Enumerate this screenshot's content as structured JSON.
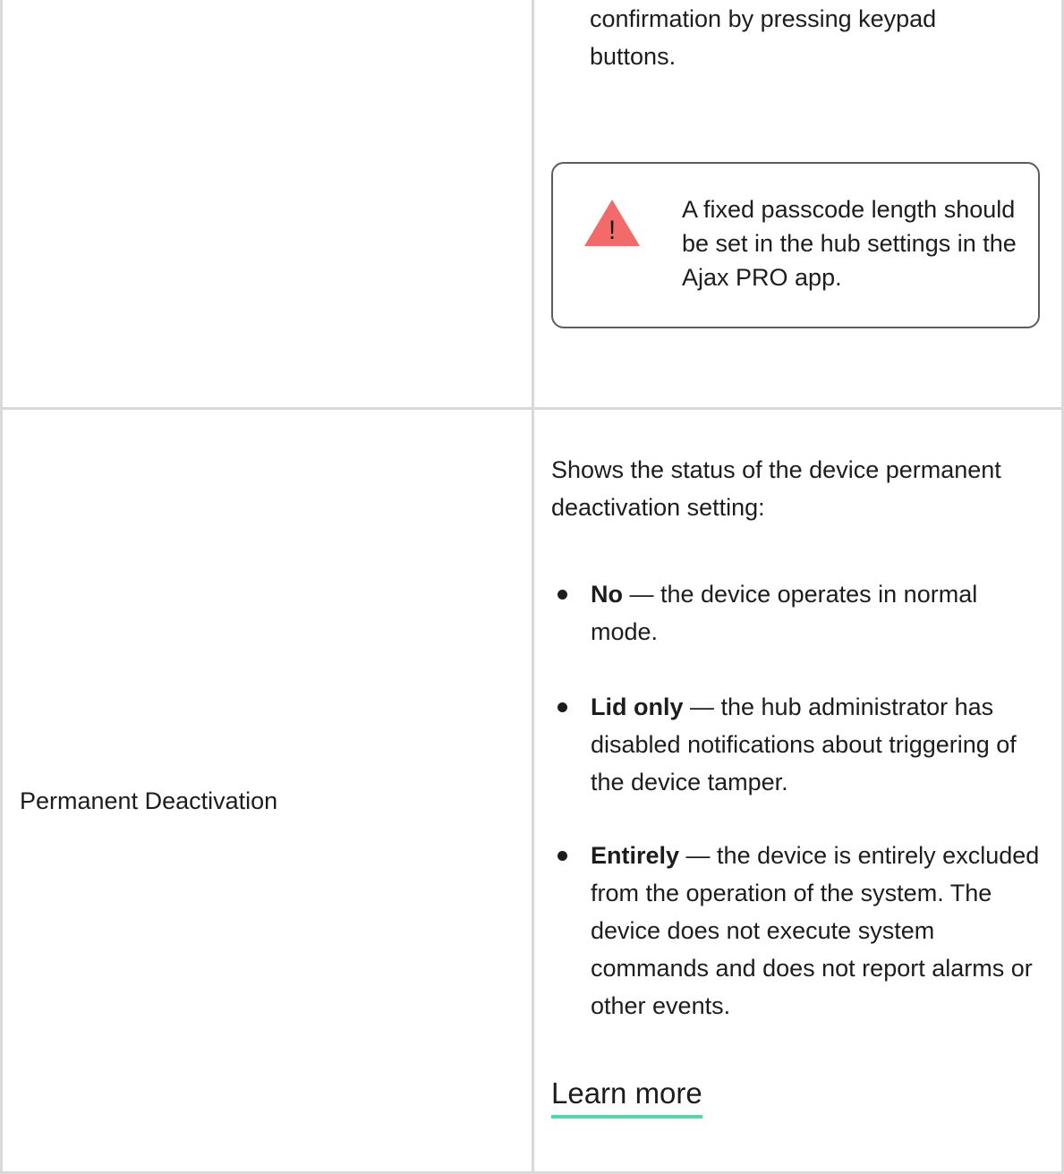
{
  "row1": {
    "description_tail": "confirmation by pressing keypad buttons.",
    "notice": {
      "icon": "warning-triangle-icon",
      "icon_color": "#f26a6a",
      "text": "A fixed passcode length should be set in the hub settings in the Ajax PRO app."
    }
  },
  "row2": {
    "label": "Permanent Deactivation",
    "intro": "Shows the status of the device permanent deactivation setting:",
    "items": [
      {
        "term": "No",
        "text": " — the device operates in normal mode."
      },
      {
        "term": "Lid only",
        "text": " — the hub administrator has disabled notifications about triggering of the device tamper."
      },
      {
        "term": "Entirely",
        "text": " — the device is entirely excluded from the operation of the system. The device does not execute system commands and does not report alarms or other events."
      }
    ],
    "link": "Learn more",
    "link_underline_color": "#4fd9a5"
  }
}
